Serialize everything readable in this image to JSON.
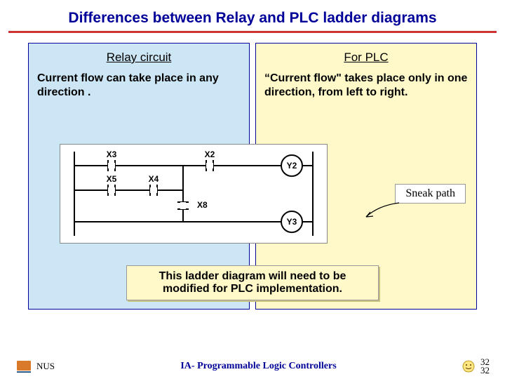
{
  "title": "Differences between Relay and PLC ladder diagrams",
  "left": {
    "heading": "Relay circuit",
    "body": "Current flow can take place in any direction ."
  },
  "right": {
    "heading": "For PLC",
    "body": "“Current flow\" takes place only in one direction, from left to right."
  },
  "sneak": "Sneak path",
  "note": "This ladder diagram will need to be modified for PLC implementation.",
  "ladder": {
    "x3": "X3",
    "x2": "X2",
    "x5": "X5",
    "x4": "X4",
    "x8": "X8",
    "y2": "Y2",
    "y3": "Y3"
  },
  "footer": {
    "org": "NUS",
    "center": "IA- Programmable Logic Controllers",
    "page_a": "32",
    "page_b": "32"
  }
}
